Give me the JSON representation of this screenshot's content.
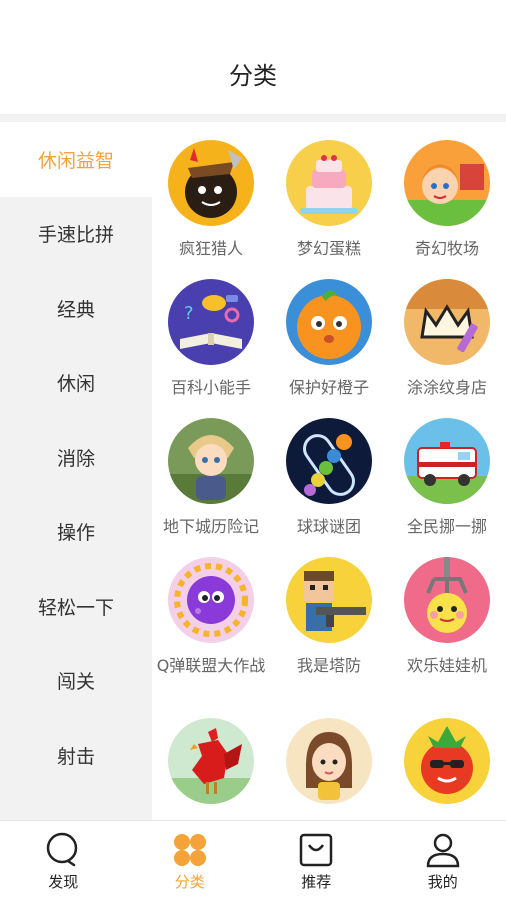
{
  "header": {
    "title": "分类"
  },
  "sidebar": {
    "items": [
      {
        "label": "休闲益智",
        "active": true
      },
      {
        "label": "手速比拼",
        "active": false
      },
      {
        "label": "经典",
        "active": false
      },
      {
        "label": "休闲",
        "active": false
      },
      {
        "label": "消除",
        "active": false
      },
      {
        "label": "操作",
        "active": false
      },
      {
        "label": "轻松一下",
        "active": false
      },
      {
        "label": "闯关",
        "active": false
      },
      {
        "label": "射击",
        "active": false
      },
      {
        "label": "",
        "active": false
      }
    ]
  },
  "games": [
    {
      "name": "疯狂猎人",
      "icon": "hunter-game-icon"
    },
    {
      "name": "梦幻蛋糕",
      "icon": "cake-game-icon"
    },
    {
      "name": "奇幻牧场",
      "icon": "farm-game-icon"
    },
    {
      "name": "百科小能手",
      "icon": "encyclopedia-game-icon"
    },
    {
      "name": "保护好橙子",
      "icon": "orange-game-icon"
    },
    {
      "name": "涂涂纹身店",
      "icon": "tattoo-game-icon"
    },
    {
      "name": "地下城历险记",
      "icon": "dungeon-game-icon"
    },
    {
      "name": "球球谜团",
      "icon": "ball-puzzle-game-icon"
    },
    {
      "name": "全民挪一挪",
      "icon": "ambulance-game-icon"
    },
    {
      "name": "Q弹联盟大作战",
      "icon": "jelly-game-icon"
    },
    {
      "name": "我是塔防",
      "icon": "tower-defense-game-icon"
    },
    {
      "name": "欢乐娃娃机",
      "icon": "claw-machine-game-icon"
    },
    {
      "name": "",
      "icon": "rooster-game-icon"
    },
    {
      "name": "",
      "icon": "girl-game-icon"
    },
    {
      "name": "",
      "icon": "tomato-game-icon"
    }
  ],
  "tabbar": {
    "tabs": [
      {
        "label": "发现",
        "icon": "discover-icon",
        "active": false
      },
      {
        "label": "分类",
        "icon": "category-icon",
        "active": true
      },
      {
        "label": "推荐",
        "icon": "recommend-bag-icon",
        "active": false
      },
      {
        "label": "我的",
        "icon": "profile-icon",
        "active": false
      }
    ]
  },
  "colors": {
    "accent": "#f3a338",
    "sidebar_bg": "#f2f2f2",
    "text": "#333333"
  }
}
